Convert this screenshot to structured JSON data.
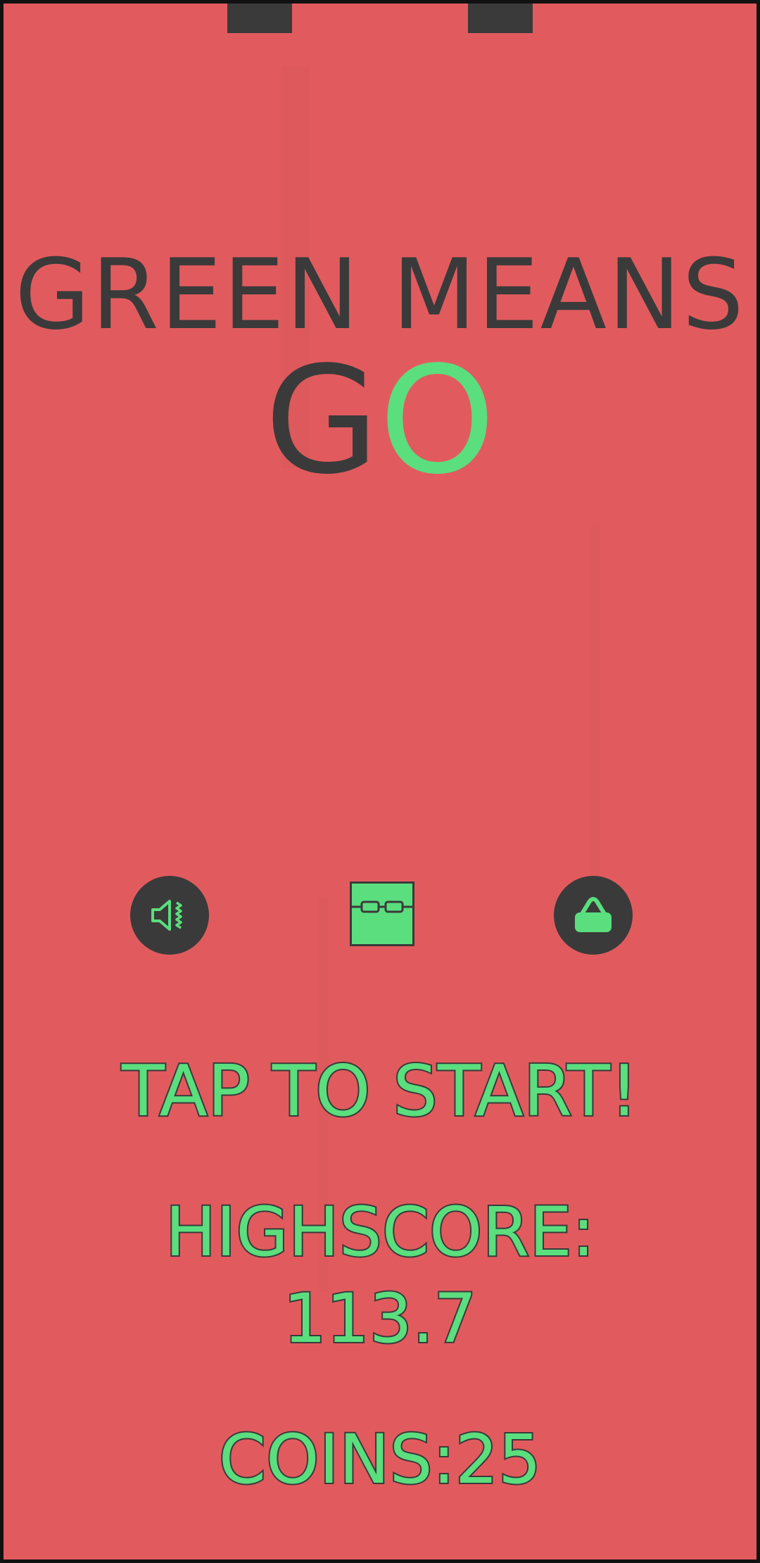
{
  "colors": {
    "background": "#E15B5E",
    "dark": "#3A3A3A",
    "green": "#5BDE7E",
    "frame": "#111111",
    "streak": "#D85558"
  },
  "title": {
    "line1": "GREEN MEANS",
    "go_g": "G",
    "go_o": "O"
  },
  "buttons": {
    "sound_icon": "speaker-icon",
    "character_icon": "glasses-character-icon",
    "shop_icon": "shop-bag-icon"
  },
  "tap_to_start": "TAP TO START!",
  "highscore": {
    "label": "HIGHSCORE:",
    "value": "113.7"
  },
  "coins": "COINS:25"
}
